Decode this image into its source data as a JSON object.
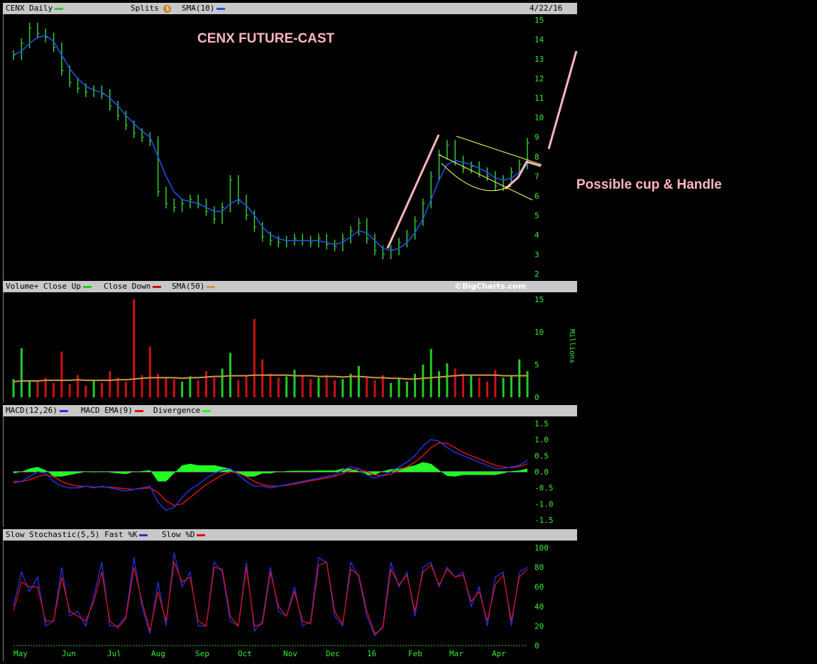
{
  "price_panel": {
    "ticker_label": "CENX Daily",
    "splits_label": "Splits",
    "splits_badge": "S",
    "sma_label": "SMA(10)",
    "date": "4/22/16",
    "title_annotation": "CENX FUTURE-CAST",
    "side_annotation": "Possible cup & Handle"
  },
  "volume_panel": {
    "title": "Volume+",
    "close_up_label": "Close Up",
    "close_down_label": "Close Down",
    "sma_label": "SMA(50)",
    "watermark": "©BigCharts.com",
    "unit_label": "Millions"
  },
  "macd_panel": {
    "title": "MACD(12,26)",
    "ema_label": "MACD EMA(9)",
    "divergence_label": "Divergence"
  },
  "stoch_panel": {
    "title": "Slow Stochastic(5,5)",
    "fast_label": "Fast %K",
    "slow_label": "Slow %D"
  },
  "colors": {
    "price": "#33cc33",
    "sma": "#2255ee",
    "up": "#22cc22",
    "down": "#cc1111",
    "vol_sma": "#cc9944",
    "divergence": "#22ff22",
    "annotation": "#ffb6c1",
    "trendline": "#ffff66"
  },
  "chart_data": [
    {
      "type": "line",
      "name": "price",
      "x_ticks": [
        "May",
        "Jun",
        "Jul",
        "Aug",
        "Sep",
        "Oct",
        "Nov",
        "Dec",
        "16",
        "Feb",
        "Mar",
        "Apr"
      ],
      "ylim": [
        2,
        15
      ],
      "y_ticks": [
        2,
        3,
        4,
        5,
        6,
        7,
        8,
        9,
        10,
        11,
        12,
        13,
        14,
        15
      ],
      "series": [
        {
          "name": "CENX Daily",
          "values": [
            13.2,
            13.8,
            14.6,
            14.3,
            14.1,
            13.6,
            12.4,
            11.8,
            11.5,
            11.3,
            11.4,
            11.2,
            10.6,
            10.1,
            9.6,
            9.2,
            9.0,
            8.8,
            6.2,
            5.6,
            5.4,
            5.6,
            5.8,
            5.6,
            5.2,
            4.8,
            5.4,
            6.8,
            5.8,
            5.0,
            4.4,
            3.9,
            3.7,
            3.6,
            3.7,
            3.8,
            3.7,
            3.6,
            3.8,
            3.5,
            3.4,
            3.8,
            4.2,
            4.6,
            3.8,
            3.2,
            3.0,
            3.2,
            3.6,
            4.0,
            4.7,
            5.6,
            7.0,
            8.1,
            8.6,
            7.8,
            7.4,
            7.5,
            7.2,
            7.0,
            6.5,
            6.8,
            7.2,
            7.6,
            8.7
          ]
        },
        {
          "name": "SMA(10)",
          "values": [
            13.2,
            13.4,
            13.8,
            14.1,
            14.2,
            13.9,
            13.2,
            12.5,
            12.0,
            11.6,
            11.4,
            11.3,
            11.0,
            10.6,
            10.1,
            9.7,
            9.3,
            9.0,
            8.0,
            7.0,
            6.2,
            5.8,
            5.7,
            5.6,
            5.4,
            5.2,
            5.2,
            5.6,
            5.8,
            5.5,
            5.0,
            4.4,
            4.0,
            3.8,
            3.7,
            3.7,
            3.7,
            3.7,
            3.7,
            3.6,
            3.5,
            3.6,
            3.9,
            4.2,
            4.1,
            3.7,
            3.3,
            3.2,
            3.3,
            3.6,
            4.1,
            4.8,
            5.8,
            6.8,
            7.6,
            7.8,
            7.7,
            7.6,
            7.4,
            7.2,
            6.9,
            6.8,
            6.9,
            7.2,
            7.6
          ]
        }
      ]
    },
    {
      "type": "bar",
      "name": "volume",
      "ylim": [
        0,
        15
      ],
      "y_ticks": [
        0,
        5,
        10,
        15
      ],
      "ylabel": "Millions",
      "values": [
        2.8,
        7.5,
        2.6,
        2.4,
        3.0,
        2.2,
        7.0,
        2.0,
        3.4,
        1.8,
        2.6,
        2.2,
        4.0,
        3.0,
        2.4,
        15.0,
        3.4,
        7.8,
        3.6,
        3.0,
        2.8,
        2.4,
        3.2,
        2.6,
        4.0,
        3.0,
        4.4,
        6.8,
        2.6,
        3.4,
        12.0,
        5.8,
        3.6,
        3.0,
        3.2,
        4.2,
        3.4,
        2.8,
        3.0,
        3.4,
        2.6,
        2.8,
        3.6,
        4.8,
        3.0,
        2.6,
        3.4,
        2.2,
        3.0,
        2.4,
        3.6,
        5.0,
        7.4,
        4.0,
        5.2,
        4.4,
        3.6,
        3.4,
        3.0,
        2.4,
        4.2,
        3.0,
        3.2,
        5.8,
        4.0
      ],
      "sma_values": [
        2.4,
        2.5,
        2.5,
        2.5,
        2.6,
        2.6,
        2.6,
        2.6,
        2.7,
        2.6,
        2.6,
        2.6,
        2.6,
        2.7,
        2.7,
        2.8,
        2.9,
        3.0,
        3.0,
        3.0,
        3.0,
        2.9,
        3.0,
        3.0,
        3.1,
        3.2,
        3.2,
        3.3,
        3.3,
        3.3,
        3.4,
        3.4,
        3.4,
        3.4,
        3.4,
        3.3,
        3.3,
        3.3,
        3.2,
        3.2,
        3.2,
        3.1,
        3.2,
        3.2,
        3.1,
        3.0,
        3.0,
        2.9,
        2.9,
        2.8,
        2.8,
        2.9,
        3.0,
        3.1,
        3.2,
        3.3,
        3.4,
        3.4,
        3.4,
        3.4,
        3.4,
        3.3,
        3.3,
        3.3,
        3.3
      ]
    },
    {
      "type": "line",
      "name": "macd",
      "ylim": [
        -1.5,
        1.5
      ],
      "y_ticks": [
        1.5,
        1.0,
        0.5,
        0.0,
        -0.5,
        -1.0,
        -1.5
      ],
      "series": [
        {
          "name": "MACD(12,26)",
          "values": [
            -0.35,
            -0.3,
            -0.15,
            0.0,
            -0.05,
            -0.3,
            -0.45,
            -0.5,
            -0.5,
            -0.45,
            -0.5,
            -0.45,
            -0.5,
            -0.55,
            -0.6,
            -0.55,
            -0.5,
            -0.45,
            -0.95,
            -1.2,
            -1.1,
            -0.8,
            -0.55,
            -0.4,
            -0.2,
            -0.05,
            0.05,
            0.1,
            -0.1,
            -0.3,
            -0.45,
            -0.45,
            -0.5,
            -0.45,
            -0.4,
            -0.35,
            -0.3,
            -0.25,
            -0.2,
            -0.15,
            -0.1,
            0.05,
            0.15,
            0.1,
            -0.1,
            -0.2,
            -0.1,
            0.0,
            0.15,
            0.3,
            0.5,
            0.8,
            1.0,
            0.95,
            0.75,
            0.6,
            0.5,
            0.4,
            0.3,
            0.2,
            0.1,
            0.1,
            0.15,
            0.2,
            0.35
          ]
        },
        {
          "name": "MACD EMA(9)",
          "values": [
            -0.3,
            -0.3,
            -0.25,
            -0.15,
            -0.1,
            -0.15,
            -0.3,
            -0.4,
            -0.45,
            -0.45,
            -0.48,
            -0.47,
            -0.48,
            -0.5,
            -0.53,
            -0.55,
            -0.52,
            -0.5,
            -0.65,
            -0.9,
            -1.05,
            -1.0,
            -0.8,
            -0.6,
            -0.4,
            -0.25,
            -0.1,
            0.0,
            -0.05,
            -0.15,
            -0.3,
            -0.4,
            -0.45,
            -0.45,
            -0.42,
            -0.38,
            -0.33,
            -0.28,
            -0.24,
            -0.19,
            -0.14,
            -0.05,
            0.05,
            0.08,
            0.0,
            -0.1,
            -0.12,
            -0.08,
            0.05,
            0.15,
            0.3,
            0.5,
            0.75,
            0.9,
            0.88,
            0.75,
            0.6,
            0.5,
            0.4,
            0.3,
            0.2,
            0.15,
            0.13,
            0.16,
            0.25
          ]
        },
        {
          "name": "Divergence",
          "values": [
            -0.05,
            0.0,
            0.1,
            0.15,
            0.05,
            -0.15,
            -0.15,
            -0.1,
            -0.05,
            0.0,
            -0.02,
            0.02,
            -0.02,
            -0.05,
            -0.07,
            0.0,
            0.02,
            0.05,
            -0.3,
            -0.3,
            -0.05,
            0.2,
            0.25,
            0.2,
            0.2,
            0.2,
            0.15,
            0.1,
            -0.05,
            -0.15,
            -0.15,
            -0.05,
            -0.05,
            0.0,
            0.02,
            0.03,
            0.03,
            0.03,
            0.04,
            0.04,
            0.04,
            0.1,
            0.1,
            0.02,
            -0.1,
            -0.1,
            0.02,
            0.08,
            0.1,
            0.15,
            0.2,
            0.3,
            0.25,
            0.05,
            -0.13,
            -0.15,
            -0.1,
            -0.1,
            -0.1,
            -0.1,
            -0.1,
            -0.05,
            0.02,
            0.04,
            0.1
          ]
        }
      ]
    },
    {
      "type": "line",
      "name": "stochastic",
      "ylim": [
        0,
        100
      ],
      "y_ticks": [
        100,
        80,
        60,
        40,
        20,
        0
      ],
      "series": [
        {
          "name": "Fast %K",
          "values": [
            40,
            75,
            55,
            70,
            20,
            25,
            80,
            30,
            35,
            20,
            50,
            85,
            20,
            20,
            30,
            90,
            40,
            12,
            65,
            20,
            95,
            60,
            75,
            20,
            20,
            85,
            75,
            25,
            20,
            85,
            15,
            25,
            80,
            35,
            30,
            60,
            20,
            25,
            90,
            85,
            30,
            20,
            85,
            70,
            30,
            10,
            20,
            85,
            60,
            75,
            30,
            80,
            85,
            60,
            80,
            70,
            75,
            40,
            60,
            20,
            70,
            75,
            20,
            75,
            80
          ]
        },
        {
          "name": "Slow %D",
          "values": [
            35,
            65,
            60,
            60,
            25,
            25,
            70,
            35,
            30,
            25,
            45,
            75,
            25,
            18,
            28,
            80,
            45,
            15,
            55,
            25,
            85,
            65,
            70,
            25,
            20,
            80,
            78,
            30,
            20,
            80,
            20,
            22,
            75,
            40,
            30,
            55,
            25,
            22,
            82,
            85,
            35,
            22,
            78,
            72,
            35,
            12,
            18,
            78,
            62,
            72,
            35,
            75,
            82,
            62,
            78,
            70,
            72,
            45,
            55,
            25,
            62,
            72,
            25,
            70,
            78
          ]
        }
      ]
    }
  ]
}
